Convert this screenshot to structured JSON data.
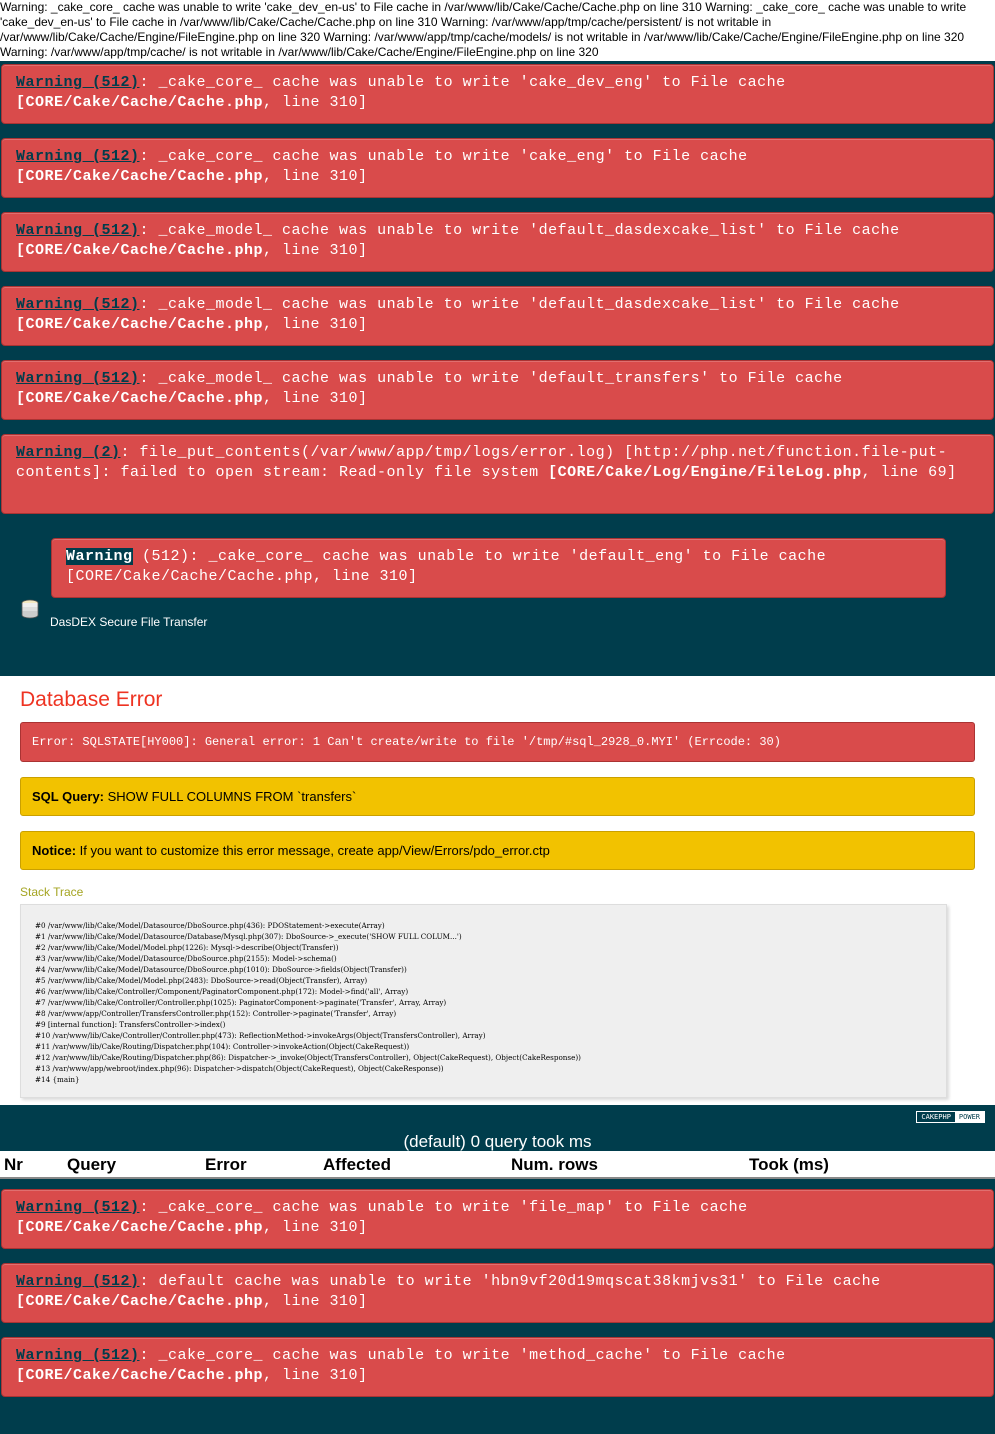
{
  "top_warning_text": "Warning: _cake_core_ cache was unable to write 'cake_dev_en-us' to File cache in /var/www/lib/Cake/Cache/Cache.php on line 310 Warning: _cake_core_ cache was unable to write 'cake_dev_en-us' to File cache in /var/www/lib/Cake/Cache/Cache.php on line 310 Warning: /var/www/app/tmp/cache/persistent/ is not writable in /var/www/lib/Cake/Cache/Engine/FileEngine.php on line 320 Warning: /var/www/app/tmp/cache/models/ is not writable in /var/www/lib/Cake/Cache/Engine/FileEngine.php on line 320 Warning: /var/www/app/tmp/cache/ is not writable in /var/www/lib/Cake/Cache/Engine/FileEngine.php on line 320",
  "warnings_top": [
    {
      "label": "Warning (512)",
      "msg": ": _cake_core_ cache was unable to write 'cake_dev_eng' to File cache ",
      "path": "[CORE/Cake/Cache/Cache.php",
      "line": ", line 310]"
    },
    {
      "label": "Warning (512)",
      "msg": ": _cake_core_ cache was unable to write 'cake_eng' to File cache ",
      "path": "[CORE/Cake/Cache/Cache.php",
      "line": ", line 310]"
    },
    {
      "label": "Warning (512)",
      "msg": ": _cake_model_ cache was unable to write 'default_dasdexcake_list' to File cache ",
      "path": "[CORE/Cake/Cache/Cache.php",
      "line": ", line 310]"
    },
    {
      "label": "Warning (512)",
      "msg": ": _cake_model_ cache was unable to write 'default_dasdexcake_list' to File cache ",
      "path": "[CORE/Cake/Cache/Cache.php",
      "line": ", line 310]"
    },
    {
      "label": "Warning (512)",
      "msg": ": _cake_model_ cache was unable to write 'default_transfers' to File cache ",
      "path": "[CORE/Cake/Cache/Cache.php",
      "line": ", line 310]"
    },
    {
      "label": "Warning (2)",
      "msg": ": file_put_contents(/var/www/app/tmp/logs/error.log) [http://php.net/function.file-put-contents]: failed to open stream: Read-only file system ",
      "path": "[CORE/Cake/Log/Engine/FileLog.php",
      "line": ", line 69]"
    }
  ],
  "header": {
    "warning": {
      "label": "Warning",
      "code": " (512)",
      "msg": ": _cake_core_ cache was unable to write 'default_eng' to File cache ",
      "path": "[CORE/Cake/Cache/Cache.php",
      "line": ", line 310]"
    },
    "site_title": "DasDEX Secure File Transfer",
    "logo_icon": "database-stack-icon"
  },
  "content": {
    "title": "Database Error",
    "error_label": "Error: ",
    "error_text": "SQLSTATE[HY000]: General error: 1 Can't create/write to file '/tmp/#sql_2928_0.MYI' (Errcode: 30)",
    "sql_label": "SQL Query: ",
    "sql_text": "SHOW FULL COLUMNS FROM `transfers`",
    "notice_label": "Notice: ",
    "notice_text": "If you want to customize this error message, create app/View/Errors/pdo_error.ctp",
    "stack_title": "Stack Trace",
    "stack_trace": "#0 /var/www/lib/Cake/Model/Datasource/DboSource.php(436): PDOStatement->execute(Array)\n#1 /var/www/lib/Cake/Model/Datasource/Database/Mysql.php(307): DboSource->_execute('SHOW FULL COLUM...')\n#2 /var/www/lib/Cake/Model/Model.php(1226): Mysql->describe(Object(Transfer))\n#3 /var/www/lib/Cake/Model/Datasource/DboSource.php(2155): Model->schema()\n#4 /var/www/lib/Cake/Model/Datasource/DboSource.php(1010): DboSource->fields(Object(Transfer))\n#5 /var/www/lib/Cake/Model/Model.php(2483): DboSource->read(Object(Transfer), Array)\n#6 /var/www/lib/Cake/Controller/Component/PaginatorComponent.php(172): Model->find('all', Array)\n#7 /var/www/lib/Cake/Controller/Controller.php(1025): PaginatorComponent->paginate('Transfer', Array, Array)\n#8 /var/www/app/Controller/TransfersController.php(152): Controller->paginate('Transfer', Array)\n#9 [internal function]: TransfersController->index()\n#10 /var/www/lib/Cake/Controller/Controller.php(473): ReflectionMethod->invokeArgs(Object(TransfersController), Array)\n#11 /var/www/lib/Cake/Routing/Dispatcher.php(104): Controller->invokeAction(Object(CakeRequest))\n#12 /var/www/lib/Cake/Routing/Dispatcher.php(86): Dispatcher->_invoke(Object(TransfersController), Object(CakeRequest), Object(CakeResponse))\n#13 /var/www/app/webroot/index.php(96): Dispatcher->dispatch(Object(CakeRequest), Object(CakeResponse))\n#14 {main}"
  },
  "footer": {
    "powered_a": "CAKEPHP",
    "powered_b": "POWER",
    "sql_summary": "(default) 0 query took ms",
    "columns": [
      "Nr",
      "Query",
      "Error",
      "Affected",
      "Num. rows",
      "Took (ms)"
    ]
  },
  "warnings_bottom": [
    {
      "label": "Warning (512)",
      "msg": ": _cake_core_ cache was unable to write 'file_map' to File cache ",
      "path": "[CORE/Cake/Cache/Cache.php",
      "line": ", line 310]"
    },
    {
      "label": "Warning (512)",
      "msg": ": default cache was unable to write 'hbn9vf20d19mqscat38kmjvs31' to File cache ",
      "path": "[CORE/Cake/Cache/Cache.php",
      "line": ", line 310]"
    },
    {
      "label": "Warning (512)",
      "msg": ": _cake_core_ cache was unable to write 'method_cache' to File cache ",
      "path": "[CORE/Cake/Cache/Cache.php",
      "line": ", line 310]"
    }
  ],
  "colors": {
    "background": "#003d4c",
    "error_red": "#d94b4b",
    "notice_yellow": "#f2c200",
    "title_red": "#ee3322"
  }
}
